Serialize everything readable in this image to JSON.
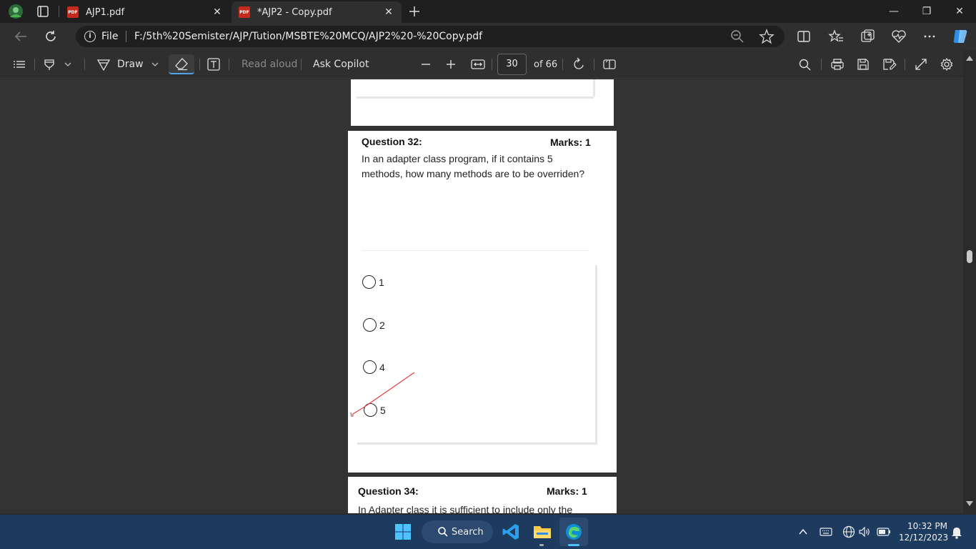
{
  "tabs": [
    {
      "title": "AJP1.pdf",
      "close": "✕",
      "badge": "PDF"
    },
    {
      "title": "*AJP2 - Copy.pdf",
      "close": "✕",
      "badge": "PDF"
    }
  ],
  "window": {
    "minimize": "—",
    "restore": "❐",
    "close": "✕"
  },
  "address": {
    "scheme_label": "File",
    "url": "F:/5th%20Semister/AJP/Tution/MSBTE%20MCQ/AJP2%20-%20Copy.pdf"
  },
  "pdf_toolbar": {
    "draw_label": "Draw",
    "read_aloud": "Read aloud",
    "ask_copilot": "Ask Copilot",
    "page_current": "30",
    "page_total": "of 66"
  },
  "question32": {
    "title": "Question 32:",
    "marks": "Marks: 1",
    "text_line1": "In an adapter class program, if it contains 5",
    "text_line2": "methods, how many methods are to be overriden?",
    "options": [
      "1",
      "2",
      "4",
      "5"
    ]
  },
  "question34": {
    "title": "Question 34:",
    "marks": "Marks: 1",
    "text_line1": "In Adapter class it is sufficient to include only the"
  },
  "taskbar": {
    "search_label": "Search",
    "time": "10:32 PM",
    "date": "12/12/2023"
  },
  "colors": {
    "accent": "#4ea3e8",
    "annotation": "#e53935",
    "taskbar": "#1d3a5f"
  }
}
